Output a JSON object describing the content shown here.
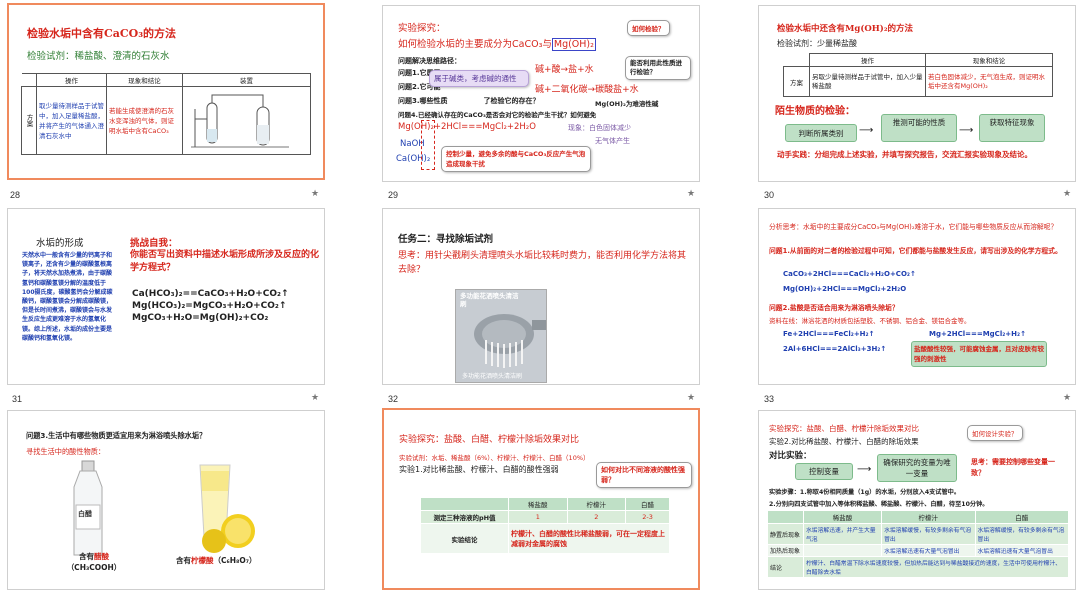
{
  "slides": [
    {
      "num": "28",
      "title": "检验水垢中含有CaCO₃的方法",
      "subtitle": "检验试剂：稀盐酸、澄清的石灰水",
      "table": {
        "headers": [
          "操作",
          "现象和结论",
          "装置"
        ],
        "row_label": "方案",
        "op": "取少量待测样品于试管中，加入足量稀盐酸，并将产生的气体通入澄清石灰水中",
        "result": "若能生成使澄清的石灰水变浑浊的气体，则证明水垢中含有CaCO₃"
      }
    },
    {
      "num": "29",
      "title": "实验探究：",
      "subtitle_pre": "如何检验水垢的主要成分为CaCO₃与",
      "subtitle_box": "Mg(OH)₂",
      "bubble_top": "如何检验？",
      "intro": "问题解决思维路径：",
      "q1": "问题1.它属于",
      "q2": "问题2.它可能",
      "q3": "问题3.哪些性质",
      "q3_tail": "了检验它的存在？",
      "q4": "问题4.已经确认存在的CaCO₃是否会对它的检验产生干扰？如何避免",
      "eq1": "碱+酸→盐+水",
      "eq2": "碱+二氧化碳→碳酸盐+水",
      "bubble_right1": "能否利用此性质进行检验？",
      "bubble_middle": "属于碱类，考虑碱的通性",
      "mgoh_tail": "Mg(OH)₂为难溶性碱",
      "reaction": "Mg(OH)₂+2HCl===MgCl₂+2H₂O",
      "phenom": "现象：白色固体减少",
      "no_gas": "无气体产生",
      "naoh": "NaOH",
      "caoh": "Ca(OH)₂",
      "bubble_bottom": "控制少量，避免多余的酸与CaCO₃反应产生气泡造成现象干扰"
    },
    {
      "num": "30",
      "title": "检验水垢中还含有Mg(OH)₂的方法",
      "subtitle": "检验试剂：少量稀盐酸",
      "table": {
        "headers": [
          "操作",
          "现象和结论"
        ],
        "row_label": "方案",
        "op": "另取少量待测样品于试管中，加入少量稀盐酸",
        "result": "若白色固体减少，无气泡生成，则证明水垢中还含有Mg(OH)₂"
      },
      "section": "陌生物质的检验：",
      "flow": [
        "判断所属类别",
        "推测可能的性质",
        "获取特征现象"
      ],
      "task": "动手实践：分组完成上述实验，并填写探究报告，交流汇报实验现象及结论。"
    },
    {
      "num": "31",
      "title": "水垢的形成",
      "body": "天然水中一般含有少量的钙离子和镁离子，还含有少量的碳酸氢根离子，将天然水加热煮沸，由于碳酸氢钙和碳酸氢镁分解的温度低于100摄氏度，碳酸氢钙会分解成碳酸钙，碳酸氢镁会分解成碳酸镁，但是长时间煮沸，碳酸镁会与水发生反应生成更难溶于水的氢氧化镁。综上所述，水垢的成份主要是碳酸钙和氢氧化镁。",
      "challenge": "挑战自我：",
      "question": "你能否写出资料中描述水垢形成所涉及反应的化学方程式？",
      "eqs": [
        "Ca(HCO₃)₂==CaCO₃+H₂O+CO₂↑",
        "Mg(HCO₃)₂=MgCO₃+H₂O+CO₂↑",
        "MgCO₃+H₂O=Mg(OH)₂+CO₂"
      ]
    },
    {
      "num": "32",
      "title": "任务二：寻找除垢试剂",
      "question": "思考：用针尖戳刷头清理喷头水垢比较耗时费力，能否利用化学方法将其去除？",
      "img_top": "多功能花洒喷头清洁刷",
      "img_bottom": "多功能花洒喷头清洁刷"
    },
    {
      "num": "33",
      "intro": "分析思考：水垢中的主要成分CaCO₃与Mg(OH)₂难溶于水，它们能与哪些物质反应从而溶解呢？",
      "q1": "问题1.从前面的对二者的检验过程中可知，它们都能与盐酸发生反应，请写出涉及的化学方程式。",
      "eq1": "CaCO₃+2HCl===CaCl₂+H₂O+CO₂↑",
      "eq2": "Mg(OH)₂+2HCl===MgCl₂+2H₂O",
      "q2": "问题2.盐酸是否适合用来为淋浴喷头除垢？",
      "info": "资料在线：淋浴花洒的材质包括塑胶、不锈钢、铝合金、镁铝合金等。",
      "eq3": "Fe+2HCl===FeCl₂+H₂↑",
      "eq4": "Mg+2HCl===MgCl₂+H₂↑",
      "eq5": "2Al+6HCl===2AlCl₃+3H₂↑",
      "note": "盐酸酸性较强，可能腐蚀金属，且对皮肤有较强的刺激性"
    },
    {
      "num": "34",
      "title": "问题3.生活中有哪些物质更适宜用来为淋浴喷头除水垢？",
      "subtitle": "寻找生活中的酸性物质：",
      "bottle_label": "白醋",
      "caption1_pre": "含有",
      "caption1_red": "醋酸",
      "caption1_formula": "（CH₃COOH）",
      "caption2_pre": "含有",
      "caption2_red": "柠檬酸",
      "caption2_formula": "（C₆H₈O₇）"
    },
    {
      "num": "35",
      "title": "实验探究：盐酸、白醋、柠檬汁除垢效果对比",
      "reagents": "实验试剂：水垢、稀盐酸（6%）、柠檬汁、柠檬汁、白醋（10%）",
      "exp": "实验1.对比稀盐酸、柠檬汁、白醋的酸性强弱",
      "bubble": "如何对比不同溶液的酸性强弱？",
      "table": {
        "headers": [
          "",
          "稀盐酸",
          "柠檬汁",
          "白醋"
        ],
        "row1_label": "测定三种溶液的pH值",
        "row1": [
          "1",
          "2",
          "2-3"
        ],
        "row2_label": "实验结论",
        "row2": "柠檬汁、白醋的酸性比稀盐酸弱，可在一定程度上减弱对金属的腐蚀"
      }
    },
    {
      "num": "36",
      "title": "实验探究：盐酸、白醋、柠檬汁除垢效果对比",
      "bubble": "如何设计实验？",
      "exp": "实验2.对比稀盐酸、柠檬汁、白醋的除垢效果",
      "compare": "对比实验：",
      "control": "控制变量",
      "unique": "确保研究的变量为唯一变量",
      "think": "思考：需要控制哪些变量一致？",
      "step1": "实验步骤：1.称取4份相同质量（1g）的水垢，分别放入4支试管中。",
      "step2": "2.分别向四支试管中加入等体积稀盐酸、稀盐酸、柠檬汁、白醋，待至10分钟。",
      "table": {
        "headers": [
          "",
          "稀盐酸",
          "柠檬汁",
          "白醋"
        ],
        "rows": [
          {
            "label": "静置后现象",
            "cells": [
              "水垢溶解迅速，并产生大量气泡",
              "水垢溶解缓慢，有较多剩余有气泡冒出",
              "水垢溶解缓慢，有较多剩余有气泡冒出"
            ]
          },
          {
            "label": "加热后现象",
            "cells": [
              "",
              "水垢溶解迅速有大量气泡冒出",
              "水垢溶解迅速有大量气泡冒出"
            ]
          },
          {
            "label": "结论",
            "cells": [
              "柠檬汁、白醋常温下除水垢速度较慢，但加热后能达到与稀盐酸接近的速度，生活中可使用柠檬汁、白醋除去水垢"
            ]
          }
        ]
      }
    }
  ],
  "star": "★",
  "colors": {
    "red": "#d6261c",
    "blue": "#1f3fb0",
    "selected_border": "#f08a5d",
    "green_box": "#bfe0c6"
  }
}
